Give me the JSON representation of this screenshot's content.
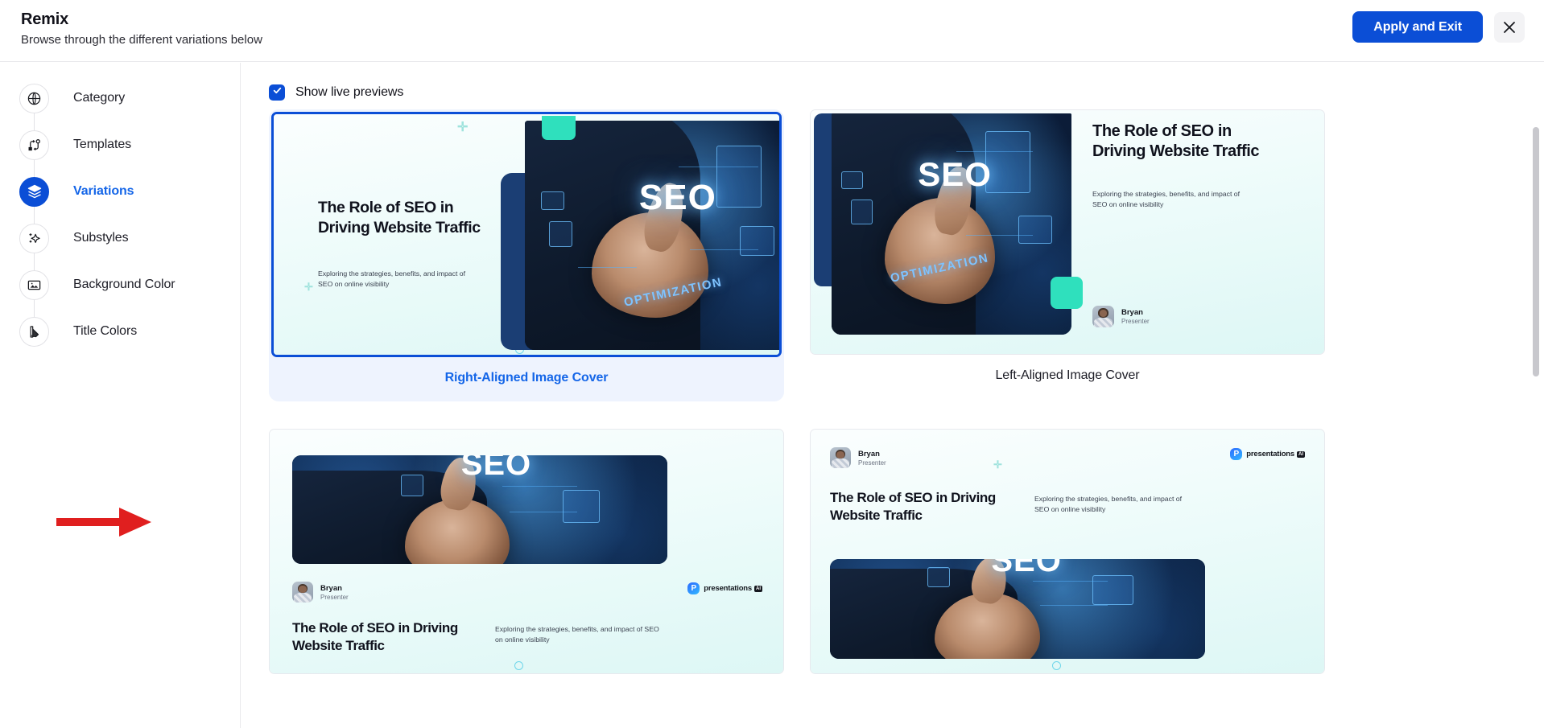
{
  "header": {
    "title": "Remix",
    "subtitle": "Browse through the different variations below",
    "apply_label": "Apply and Exit",
    "close_label": "",
    "accent_color": "#0b4ed6"
  },
  "sidebar": {
    "items": [
      {
        "label": "Category",
        "icon": "globe-icon",
        "active": false
      },
      {
        "label": "Templates",
        "icon": "templates-icon",
        "active": false
      },
      {
        "label": "Variations",
        "icon": "layers-icon",
        "active": true
      },
      {
        "label": "Substyles",
        "icon": "sparkle-icon",
        "active": false
      },
      {
        "label": "Background Color",
        "icon": "image-icon",
        "active": false
      },
      {
        "label": "Title Colors",
        "icon": "palette-icon",
        "active": false
      }
    ]
  },
  "main": {
    "show_live_previews_label": "Show live previews",
    "show_live_previews_checked": true,
    "slide_content": {
      "title": "The Role of SEO in Driving Website Traffic",
      "subtitle": "Exploring the strategies, benefits, and impact of SEO on online visibility",
      "presenter_name": "Bryan",
      "presenter_role": "Presenter",
      "brand_name": "presentations",
      "brand_suffix": "AI",
      "image_word_primary": "SEO",
      "image_word_secondary": "OPTIMIZATION"
    },
    "variations": [
      {
        "label": "Right-Aligned Image Cover",
        "selected": true
      },
      {
        "label": "Left-Aligned Image Cover",
        "selected": false
      },
      {
        "label": "",
        "selected": false
      },
      {
        "label": "",
        "selected": false
      }
    ]
  },
  "annotation": {
    "type": "red-arrow",
    "color": "#e01f1f"
  }
}
